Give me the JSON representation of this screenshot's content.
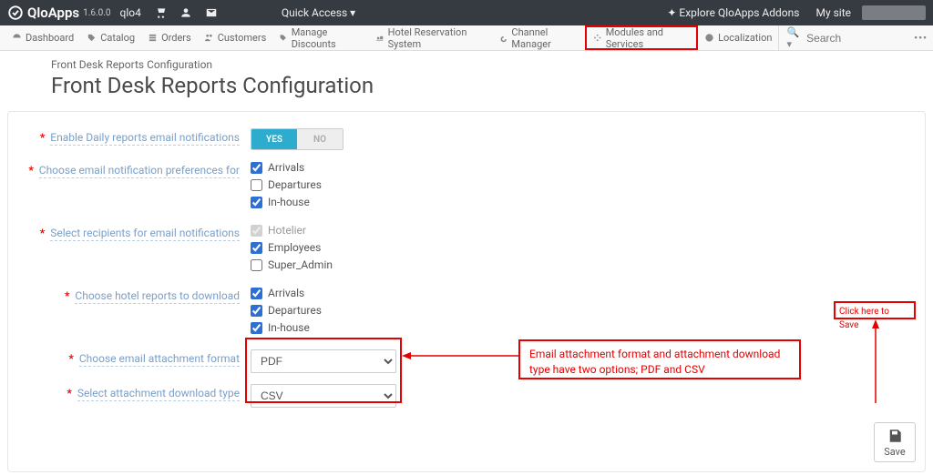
{
  "topbar": {
    "brand": "QloApps",
    "version": "1.6.0.0",
    "shop_name": "qlo4",
    "quick_access": "Quick Access",
    "addons": "Explore QloApps Addons",
    "my_site": "My site"
  },
  "nav": {
    "dashboard": "Dashboard",
    "catalog": "Catalog",
    "orders": "Orders",
    "customers": "Customers",
    "discounts": "Manage Discounts",
    "hrs": "Hotel Reservation System",
    "channel": "Channel Manager",
    "modules": "Modules and Services",
    "localization": "Localization",
    "search_placeholder": "Search"
  },
  "page": {
    "breadcrumb": "Front Desk Reports Configuration",
    "title": "Front Desk Reports Configuration"
  },
  "form": {
    "enable_label": "Enable Daily reports email notifications",
    "toggle_yes": "YES",
    "toggle_no": "NO",
    "pref_label": "Choose email notification preferences for",
    "pref_opts": [
      "Arrivals",
      "Departures",
      "In-house"
    ],
    "recip_label": "Select recipients for email notifications",
    "recip_opts": [
      "Hotelier",
      "Employees",
      "Super_Admin"
    ],
    "hotel_label": "Choose hotel reports to download",
    "hotel_opts": [
      "Arrivals",
      "Departures",
      "In-house"
    ],
    "attach_label": "Choose email attachment format",
    "attach_value": "PDF",
    "dltype_label": "Select attachment download type",
    "dltype_value": "CSV",
    "save": "Save"
  },
  "anno": {
    "explain": "Email attachment format and attachment download type have two options; PDF and CSV",
    "save_hint": "Click here to Save"
  }
}
